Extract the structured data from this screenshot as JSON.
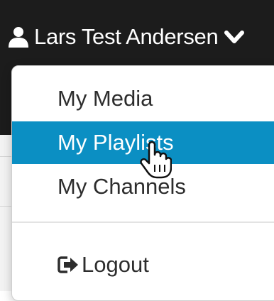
{
  "header": {
    "user_icon": "user-icon",
    "user_name": "Lars Test Andersen",
    "chevron_icon": "chevron-down-icon"
  },
  "menu": {
    "items": [
      {
        "label": "My Media"
      },
      {
        "label": "My Playlists",
        "active": true
      },
      {
        "label": "My Channels"
      }
    ],
    "logout": {
      "icon": "logout-icon",
      "label": "Logout"
    }
  },
  "colors": {
    "header_bg": "#1c1c1c",
    "active_bg": "#0b8fc3",
    "text": "#2d2d2d"
  },
  "cursor": {
    "icon": "hand-pointer-icon"
  }
}
